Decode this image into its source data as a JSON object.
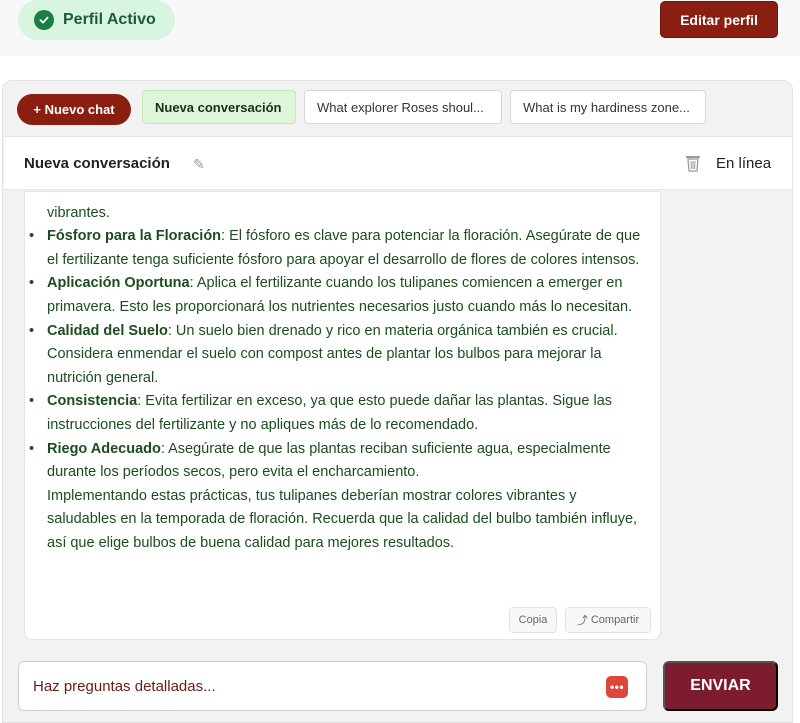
{
  "header": {
    "profile_status": "Perfil Activo",
    "edit_profile_label": "Editar perfil"
  },
  "tabs": {
    "new_chat_label": "+ Nuevo chat",
    "items": [
      {
        "label": "Nueva conversación"
      },
      {
        "label": "What explorer Roses shoul..."
      },
      {
        "label": "What is my hardiness zone..."
      }
    ]
  },
  "chat": {
    "title": "Nueva conversación",
    "status": "En línea"
  },
  "message": {
    "top_cut_text": "vibrantes.",
    "bullets": [
      {
        "term": "Fósforo para la Floración",
        "text": ": El fósforo es clave para potenciar la floración. Asegúrate de que el fertilizante tenga suficiente fósforo para apoyar el desarrollo de flores de colores intensos."
      },
      {
        "term": "Aplicación Oportuna",
        "text": ": Aplica el fertilizante cuando los tulipanes comiencen a emerger en primavera. Esto les proporcionará los nutrientes necesarios justo cuando más lo necesitan."
      },
      {
        "term": "Calidad del Suelo",
        "text": ": Un suelo bien drenado y rico en materia orgánica también es crucial. Considera enmendar el suelo con compost antes de plantar los bulbos para mejorar la nutrición general."
      },
      {
        "term": "Consistencia",
        "text": ": Evita fertilizar en exceso, ya que esto puede dañar las plantas. Sigue las instrucciones del fertilizante y no apliques más de lo recomendado."
      },
      {
        "term": "Riego Adecuado",
        "text": ": Asegúrate de que las plantas reciban suficiente agua, especialmente durante los períodos secos, pero evita el encharcamiento."
      }
    ],
    "closing": "Implementando estas prácticas, tus tulipanes deberían mostrar colores vibrantes y saludables en la temporada de floración. Recuerda que la calidad del bulbo también influye, así que elige bulbos de buena calidad para mejores resultados.",
    "copy_label": "Copia",
    "share_label": "Compartir"
  },
  "composer": {
    "placeholder": "Haz preguntas detalladas...",
    "send_label": "ENVIAR"
  },
  "colors": {
    "brand_red": "#8a1e10",
    "send_button": "#7e1c2f",
    "message_text": "#1b4d1e",
    "active_badge_bg": "#d8f5e2"
  }
}
